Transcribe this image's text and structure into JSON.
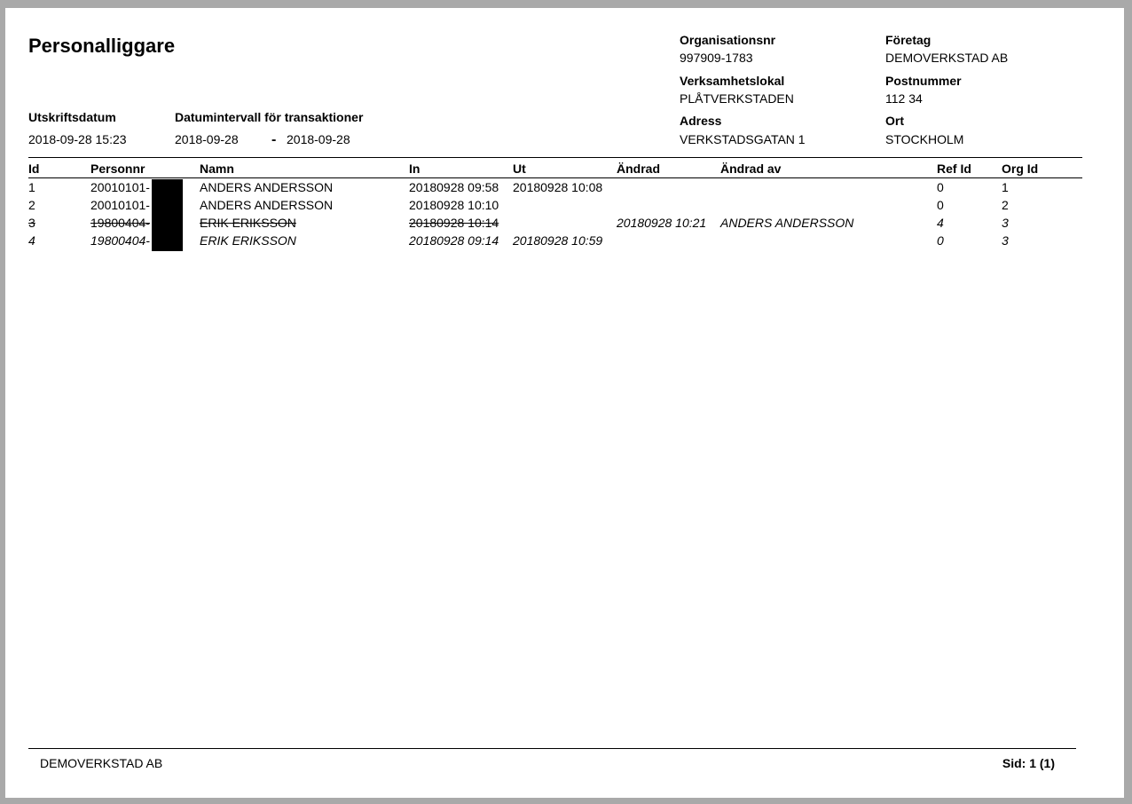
{
  "title": "Personalliggare",
  "print_date": {
    "label": "Utskriftsdatum",
    "value": "2018-09-28 15:23"
  },
  "date_range": {
    "label": "Datumintervall för transaktioner",
    "from": "2018-09-28",
    "separator": "-",
    "to": "2018-09-28"
  },
  "org": {
    "orgnr_label": "Organisationsnr",
    "orgnr": "997909-1783",
    "company_label": "Företag",
    "company": "DEMOVERKSTAD AB",
    "premises_label": "Verksamhetslokal",
    "premises": "PLÅTVERKSTADEN",
    "postal_label": "Postnummer",
    "postal": "112 34",
    "address_label": "Adress",
    "address": "VERKSTADSGATAN 1",
    "city_label": "Ort",
    "city": "STOCKHOLM"
  },
  "table": {
    "headers": {
      "id": "Id",
      "personnr": "Personnr",
      "namn": "Namn",
      "in": "In",
      "ut": "Ut",
      "andrad": "Ändrad",
      "andrad_av": "Ändrad av",
      "ref_id": "Ref Id",
      "org_id": "Org Id"
    },
    "rows": [
      {
        "id": "1",
        "personnr": "20010101-",
        "namn": "ANDERS ANDERSSON",
        "in": "20180928 09:58",
        "ut": "20180928 10:08",
        "andrad": "",
        "andrad_av": "",
        "ref_id": "0",
        "org_id": "1",
        "style": "normal"
      },
      {
        "id": "2",
        "personnr": "20010101-",
        "namn": "ANDERS ANDERSSON",
        "in": "20180928 10:10",
        "ut": "",
        "andrad": "",
        "andrad_av": "",
        "ref_id": "0",
        "org_id": "2",
        "style": "normal"
      },
      {
        "id": "3",
        "personnr": "19800404-",
        "namn": "ERIK ERIKSSON",
        "in": "20180928 10:14",
        "ut": "",
        "andrad": "20180928 10:21",
        "andrad_av": "ANDERS ANDERSSON",
        "ref_id": "4",
        "org_id": "3",
        "style": "struck"
      },
      {
        "id": "4",
        "personnr": "19800404-",
        "namn": "ERIK ERIKSSON",
        "in": "20180928 09:14",
        "ut": "20180928 10:59",
        "andrad": "",
        "andrad_av": "",
        "ref_id": "0",
        "org_id": "3",
        "style": "italic"
      }
    ]
  },
  "footer": {
    "company": "DEMOVERKSTAD AB",
    "page": "Sid: 1 (1)"
  }
}
